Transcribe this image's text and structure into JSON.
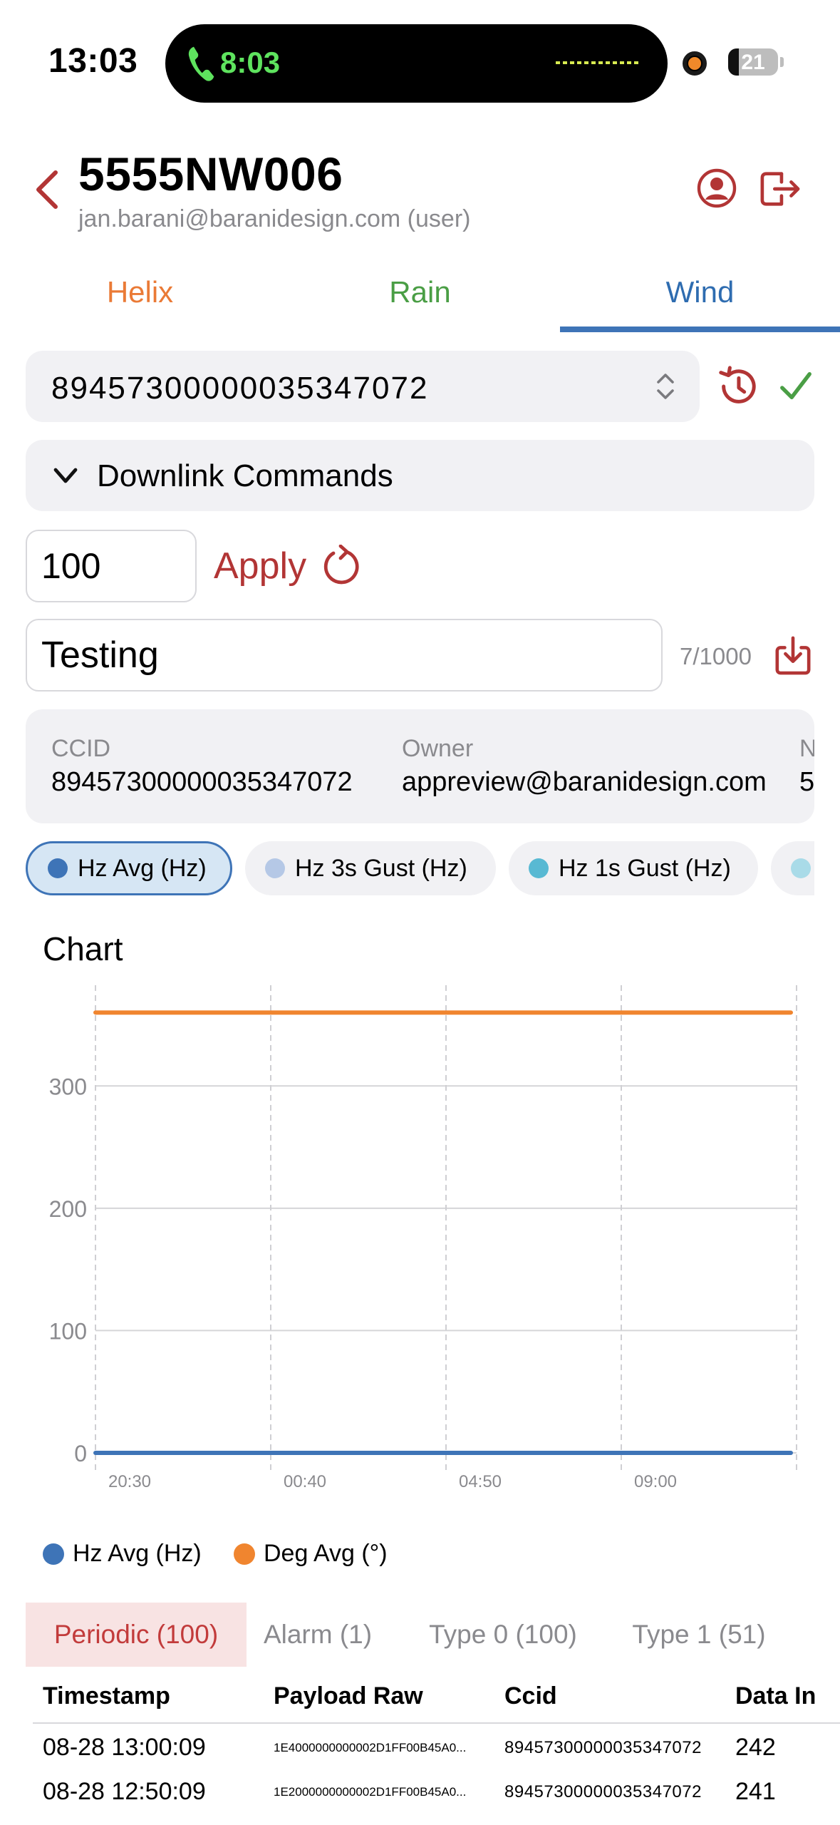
{
  "status_bar": {
    "time": "13:03",
    "call_time": "8:03",
    "battery_level": 21,
    "battery_text": "21"
  },
  "header": {
    "title": "5555NW006",
    "subtitle": "jan.barani@baranidesign.com (user)"
  },
  "tabs": [
    {
      "label": "Helix",
      "color": "#ea7a36"
    },
    {
      "label": "Rain",
      "color": "#4a9e45"
    },
    {
      "label": "Wind",
      "color": "#2e6cb0",
      "selected": true
    }
  ],
  "sim_selector": {
    "value": "89457300000035347072"
  },
  "downlink": {
    "label": "Downlink Commands"
  },
  "command": {
    "value": "100",
    "apply_label": "Apply"
  },
  "note": {
    "value": "Testing",
    "count": "7/1000"
  },
  "info": {
    "ccid_label": "CCID",
    "ccid_value": "89457300000035347072",
    "owner_label": "Owner",
    "owner_value": "appreview@baranidesign.com",
    "extra_label": "N",
    "extra_value": "5"
  },
  "chips": [
    {
      "label": "Hz Avg (Hz)",
      "color": "#3e74b7",
      "active": true
    },
    {
      "label": "Hz 3s Gust (Hz)",
      "color": "#b5c8e6",
      "active": false
    },
    {
      "label": "Hz 1s Gust (Hz)",
      "color": "#58b9d3",
      "active": false
    },
    {
      "label": "",
      "color": "#a9dbe8",
      "active": false
    }
  ],
  "chart_data": {
    "type": "line",
    "title": "Chart",
    "x": [
      "20:30",
      "00:40",
      "04:50",
      "09:00"
    ],
    "ylim": [
      0,
      380
    ],
    "yticks": [
      0,
      100,
      200,
      300
    ],
    "grid": true,
    "legend_position": "bottom",
    "series": [
      {
        "name": "Hz Avg (Hz)",
        "color": "#3e74b7",
        "values": [
          0,
          0,
          0,
          0,
          0
        ]
      },
      {
        "name": "Deg Avg (°)",
        "color": "#f0852f",
        "values": [
          360,
          360,
          360,
          360,
          360
        ]
      }
    ]
  },
  "bottom_tabs": [
    {
      "label": "Periodic (100)",
      "active": true
    },
    {
      "label": "Alarm (1)",
      "active": false
    },
    {
      "label": "Type 0 (100)",
      "active": false
    },
    {
      "label": "Type 1 (51)",
      "active": false
    }
  ],
  "table": {
    "headers": [
      "Timestamp",
      "Payload Raw",
      "Ccid",
      "Data In"
    ],
    "rows": [
      {
        "timestamp": "08-28 13:00:09",
        "payload": "1E4000000000002D1FF00B45A0...",
        "ccid": "89457300000035347072",
        "index": "242"
      },
      {
        "timestamp": "08-28 12:50:09",
        "payload": "1E2000000000002D1FF00B45A0...",
        "ccid": "89457300000035347072",
        "index": "241"
      }
    ]
  },
  "colors": {
    "accent_red": "#b23535",
    "accent_blue": "#3e74b7",
    "muted": "#8a8a8e",
    "surface": "#f1f1f4"
  }
}
